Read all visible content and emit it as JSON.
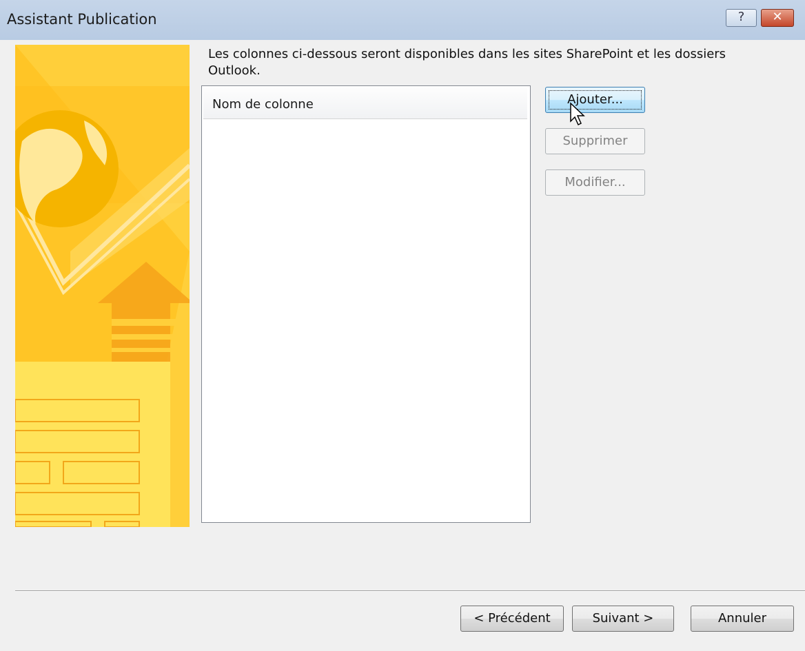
{
  "window": {
    "title": "Assistant Publication",
    "help_glyph": "?",
    "close_glyph": "✕"
  },
  "instruction": "Les colonnes ci-dessous seront disponibles dans les sites SharePoint et les dossiers Outlook.",
  "columns_list": {
    "header": "Nom de colonne",
    "items": []
  },
  "side_buttons": {
    "add": "Ajouter...",
    "remove": "Supprimer",
    "edit": "Modifier..."
  },
  "footer": {
    "previous": "< Précédent",
    "next": "Suivant >",
    "cancel": "Annuler"
  },
  "colors": {
    "banner": "#ffc526",
    "titlebar": "#c5d5e9",
    "close_button": "#c4462a"
  },
  "icons": [
    "help-icon",
    "close-icon",
    "globe-icon",
    "up-arrow-icon",
    "document-icon",
    "pointer-cursor-icon"
  ]
}
